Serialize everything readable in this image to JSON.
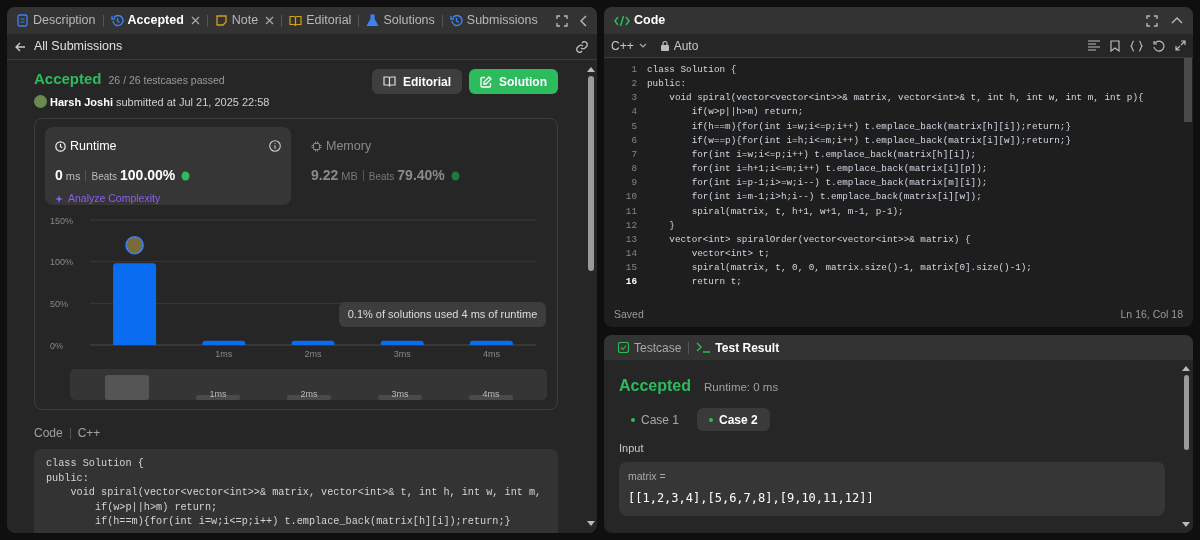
{
  "tabs": [
    {
      "label": "Description",
      "kind": "description",
      "selected": false,
      "closable": false
    },
    {
      "label": "Accepted",
      "kind": "accepted",
      "selected": true,
      "closable": true
    },
    {
      "label": "Note",
      "kind": "note",
      "selected": false,
      "closable": true
    },
    {
      "label": "Editorial",
      "kind": "editorial",
      "selected": false,
      "closable": false
    },
    {
      "label": "Solutions",
      "kind": "solutions",
      "selected": false,
      "closable": false
    },
    {
      "label": "Submissions",
      "kind": "submissions",
      "selected": false,
      "closable": false
    }
  ],
  "back_link": "All Submissions",
  "submission": {
    "status": "Accepted",
    "testcases": "26 / 26 testcases passed",
    "author": "Harsh Joshi",
    "submitted": "submitted at Jul 21, 2025 22:58"
  },
  "actions": [
    {
      "label": "Editorial",
      "kind": "secondary"
    },
    {
      "label": "Solution",
      "kind": "primary"
    }
  ],
  "metrics": [
    {
      "kind": "runtime",
      "title": "Runtime",
      "value": "0",
      "unit": "ms",
      "beats_label": "Beats",
      "beats": "100.00%",
      "selected": true,
      "analyze": "Analyze Complexity"
    },
    {
      "kind": "memory",
      "title": "Memory",
      "value": "9.22",
      "unit": "MB",
      "beats_label": "Beats",
      "beats": "79.40%",
      "selected": false
    }
  ],
  "chart_data": {
    "type": "bar",
    "x": [
      0,
      1,
      2,
      3,
      4
    ],
    "values": [
      98,
      5,
      5,
      5,
      5
    ],
    "xlim": [
      -0.5,
      4.5
    ],
    "ylim": [
      0,
      150
    ],
    "yticks": [
      {
        "value": 0,
        "label": "0%"
      },
      {
        "value": 50,
        "label": "50%"
      },
      {
        "value": 100,
        "label": "100%"
      },
      {
        "value": 150,
        "label": "150%"
      }
    ],
    "xticks": [
      {
        "value": 1,
        "label": "1ms"
      },
      {
        "value": 2,
        "label": "2ms"
      },
      {
        "value": 3,
        "label": "3ms"
      },
      {
        "value": 4,
        "label": "4ms"
      }
    ]
  },
  "tooltip": "0.1% of solutions used 4 ms of runtime",
  "navigator_labels": [
    "1ms",
    "2ms",
    "3ms",
    "4ms"
  ],
  "code_section": {
    "title": "Code",
    "language": "C++",
    "lines": [
      "class Solution {",
      "public:",
      "    void spiral(vector<vector<int>>& matrix, vector<int>& t, int h, int w, int m,",
      "        if(w>p||h>m) return;",
      "        if(h==m){for(int i=w;i<=p;i++) t.emplace_back(matrix[h][i]);return;}"
    ]
  },
  "editor": {
    "title": "Code",
    "language": "C++",
    "mode": "Auto",
    "lines": [
      {
        "number": "1",
        "text": "class Solution {",
        "current": false
      },
      {
        "number": "2",
        "text": "public:",
        "current": false
      },
      {
        "number": "3",
        "text": "    void spiral(vector<vector<int>>& matrix, vector<int>& t, int h, int w, int m, int p){",
        "current": false
      },
      {
        "number": "4",
        "text": "        if(w>p||h>m) return;",
        "current": false
      },
      {
        "number": "5",
        "text": "        if(h==m){for(int i=w;i<=p;i++) t.emplace_back(matrix[h][i]);return;}",
        "current": false
      },
      {
        "number": "6",
        "text": "        if(w==p){for(int i=h;i<=m;i++) t.emplace_back(matrix[i][w]);return;}",
        "current": false
      },
      {
        "number": "7",
        "text": "        for(int i=w;i<=p;i++) t.emplace_back(matrix[h][i]);",
        "current": false
      },
      {
        "number": "8",
        "text": "        for(int i=h+1;i<=m;i++) t.emplace_back(matrix[i][p]);",
        "current": false
      },
      {
        "number": "9",
        "text": "        for(int i=p-1;i>=w;i--) t.emplace_back(matrix[m][i]);",
        "current": false
      },
      {
        "number": "10",
        "text": "        for(int i=m-1;i>h;i--) t.emplace_back(matrix[i][w]);",
        "current": false
      },
      {
        "number": "11",
        "text": "        spiral(matrix, t, h+1, w+1, m-1, p-1);",
        "current": false
      },
      {
        "number": "12",
        "text": "    }",
        "current": false
      },
      {
        "number": "13",
        "text": "    vector<int> spiralOrder(vector<vector<int>>& matrix) {",
        "current": false
      },
      {
        "number": "14",
        "text": "        vector<int> t;",
        "current": false
      },
      {
        "number": "15",
        "text": "        spiral(matrix, t, 0, 0, matrix.size()-1, matrix[0].size()-1);",
        "current": false
      },
      {
        "number": "16",
        "text": "        return t;",
        "current": true
      }
    ],
    "status": "Saved",
    "cursor": "Ln 16, Col 18"
  },
  "console": {
    "tabs": [
      {
        "label": "Testcase",
        "kind": "testcase",
        "selected": false
      },
      {
        "label": "Test Result",
        "kind": "result",
        "selected": true
      }
    ],
    "status": "Accepted",
    "runtime": "Runtime: 0 ms",
    "cases": [
      {
        "label": "Case 1",
        "selected": false
      },
      {
        "label": "Case 2",
        "selected": true
      }
    ],
    "input_label": "Input",
    "inputs": [
      {
        "name": "matrix =",
        "value": "[[1,2,3,4],[5,6,7,8],[9,10,11,12]]"
      }
    ]
  }
}
